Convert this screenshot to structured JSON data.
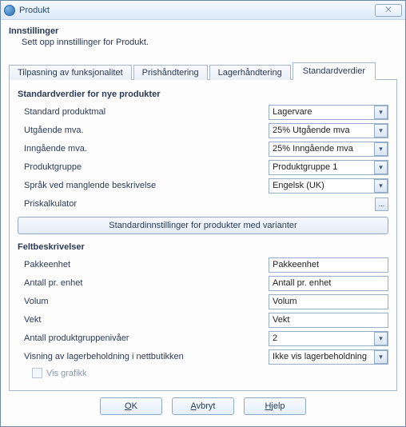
{
  "window": {
    "title": "Produkt",
    "close_glyph": "⨉"
  },
  "header": {
    "title": "Innstillinger",
    "subtitle": "Sett opp innstillinger for Produkt."
  },
  "tabs": {
    "functionality": "Tilpasning av funksjonalitet",
    "pricing": "Prishåndtering",
    "inventory": "Lagerhåndtering",
    "defaults": "Standardverdier"
  },
  "defaults_section": {
    "title": "Standardverdier for nye produkter",
    "rows": {
      "template": {
        "label": "Standard produktmal",
        "value": "Lagervare"
      },
      "vat_out": {
        "label": "Utgående mva.",
        "value": "25%  Utgående mva"
      },
      "vat_in": {
        "label": "Inngående mva.",
        "value": "25% Inngående mva"
      },
      "group": {
        "label": "Produktgruppe",
        "value": "Produktgruppe 1"
      },
      "lang": {
        "label": "Språk ved manglende beskrivelse",
        "value": "Engelsk (UK)"
      },
      "pricecalc": {
        "label": "Priskalkulator"
      }
    },
    "variant_button": "Standardinnstillinger for produkter med varianter"
  },
  "fields_section": {
    "title": "Feltbeskrivelser",
    "rows": {
      "pack_unit": {
        "label": "Pakkeenhet",
        "value": "Pakkeenhet"
      },
      "per_unit": {
        "label": "Antall pr. enhet",
        "value": "Antall pr. enhet"
      },
      "volume": {
        "label": "Volum",
        "value": "Volum"
      },
      "weight": {
        "label": "Vekt",
        "value": "Vekt"
      },
      "group_levels": {
        "label": "Antall produktgruppenivåer",
        "value": "2"
      },
      "stock_show": {
        "label": "Visning av lagerbeholdning i nettbutikken",
        "value": "Ikke vis lagerbeholdning"
      }
    },
    "show_graphics": "Vis grafikk"
  },
  "footer": {
    "ok": "OK",
    "cancel": "Avbryt",
    "help": "Hjelp"
  },
  "glyphs": {
    "down": "▾",
    "ellipsis": "..."
  }
}
